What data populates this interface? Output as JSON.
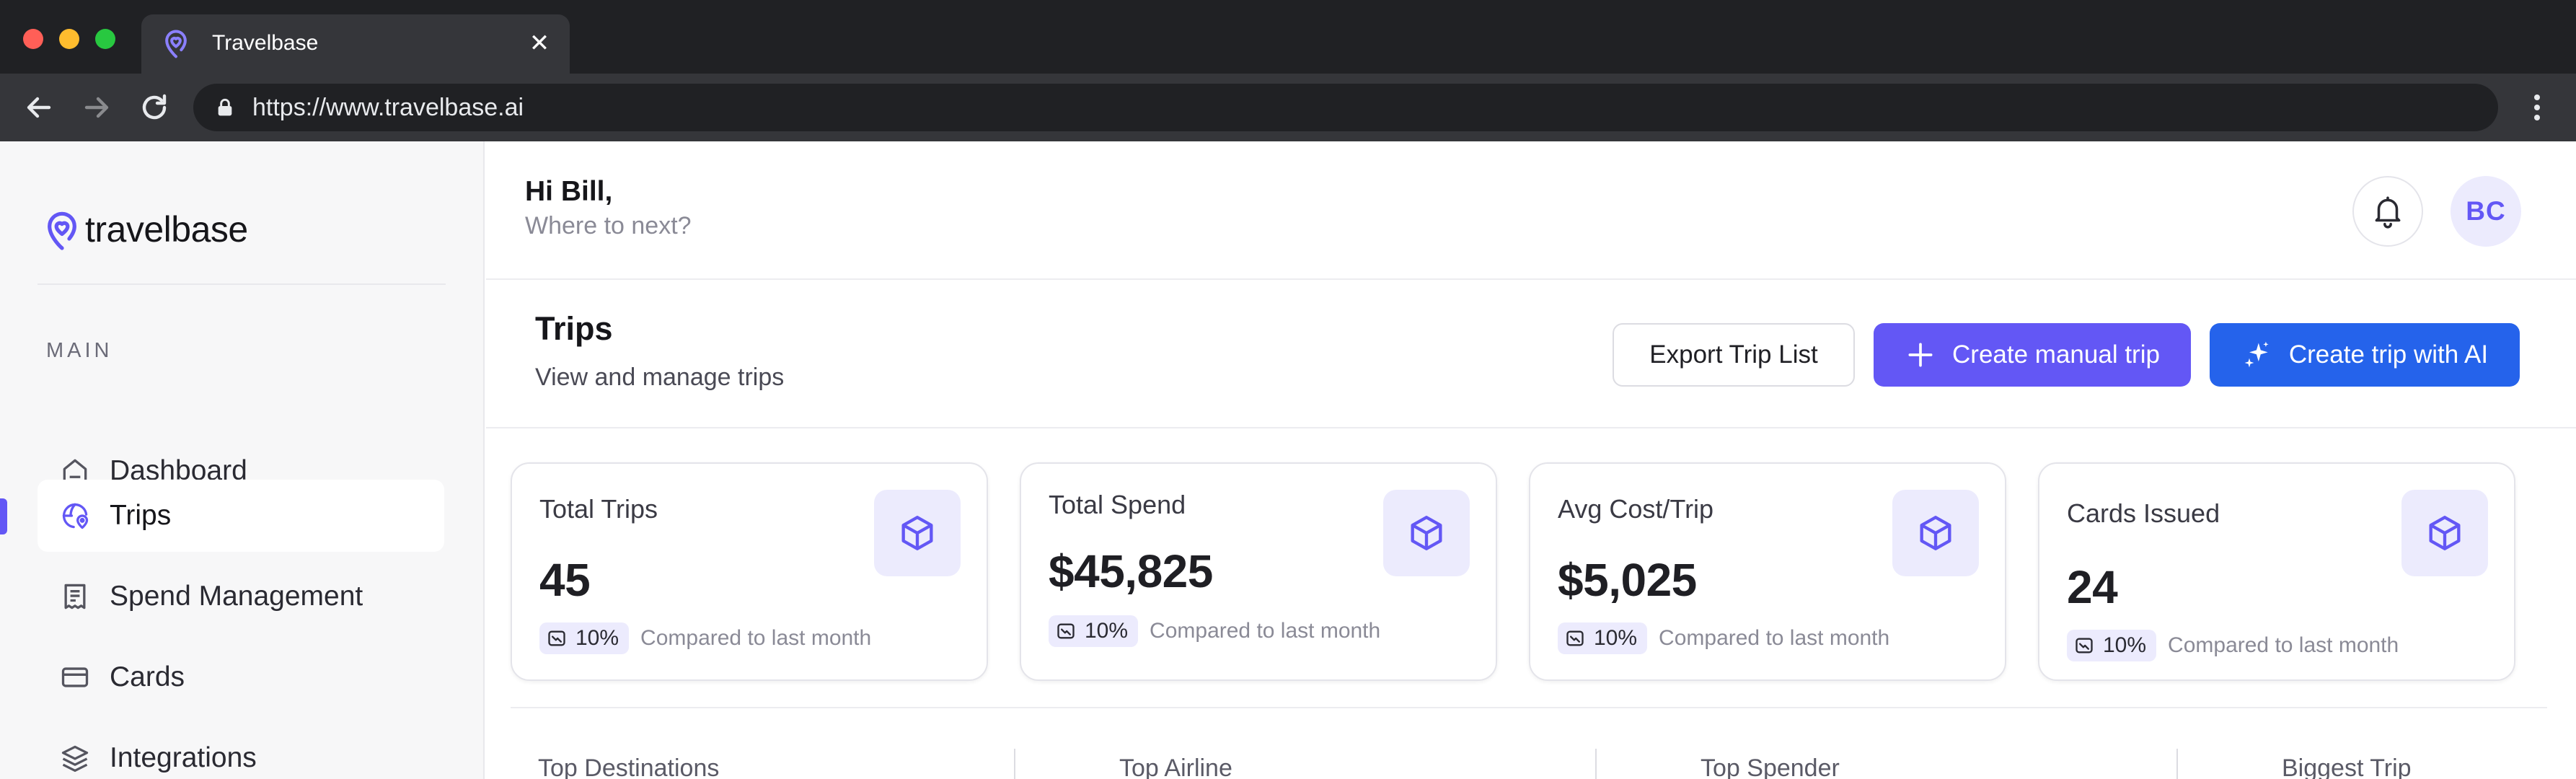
{
  "browser": {
    "tab_title": "Travelbase",
    "url": "https://www.travelbase.ai"
  },
  "brand": {
    "name": "travelbase",
    "accent": "#6357f5",
    "ai_button_color": "#2563eb"
  },
  "sidebar": {
    "section_label": "MAIN",
    "items": [
      {
        "label": "Dashboard",
        "icon": "home-icon",
        "active": false
      },
      {
        "label": "Trips",
        "icon": "globe-pin-icon",
        "active": true
      },
      {
        "label": "Spend Management",
        "icon": "receipt-icon",
        "active": false
      },
      {
        "label": "Cards",
        "icon": "credit-card-icon",
        "active": false
      },
      {
        "label": "Integrations",
        "icon": "layers-icon",
        "active": false
      }
    ]
  },
  "header": {
    "greeting": "Hi Bill,",
    "subgreeting": "Where to next?",
    "avatar_initials": "BC"
  },
  "page": {
    "title": "Trips",
    "subtitle": "View and manage trips",
    "buttons": {
      "export": "Export Trip List",
      "manual": "Create manual trip",
      "ai": "Create trip with AI"
    }
  },
  "stats": [
    {
      "label": "Total Trips",
      "value": "45",
      "change": "10%",
      "compare": "Compared to last month"
    },
    {
      "label": "Total Spend",
      "value": "$45,825",
      "change": "10%",
      "compare": "Compared to last month"
    },
    {
      "label": "Avg Cost/Trip",
      "value": "$5,025",
      "change": "10%",
      "compare": "Compared to last month"
    },
    {
      "label": "Cards Issued",
      "value": "24",
      "change": "10%",
      "compare": "Compared to last month"
    }
  ],
  "bottom_sections": [
    "Top Destinations",
    "Top Airline",
    "Top Spender",
    "Biggest Trip"
  ]
}
